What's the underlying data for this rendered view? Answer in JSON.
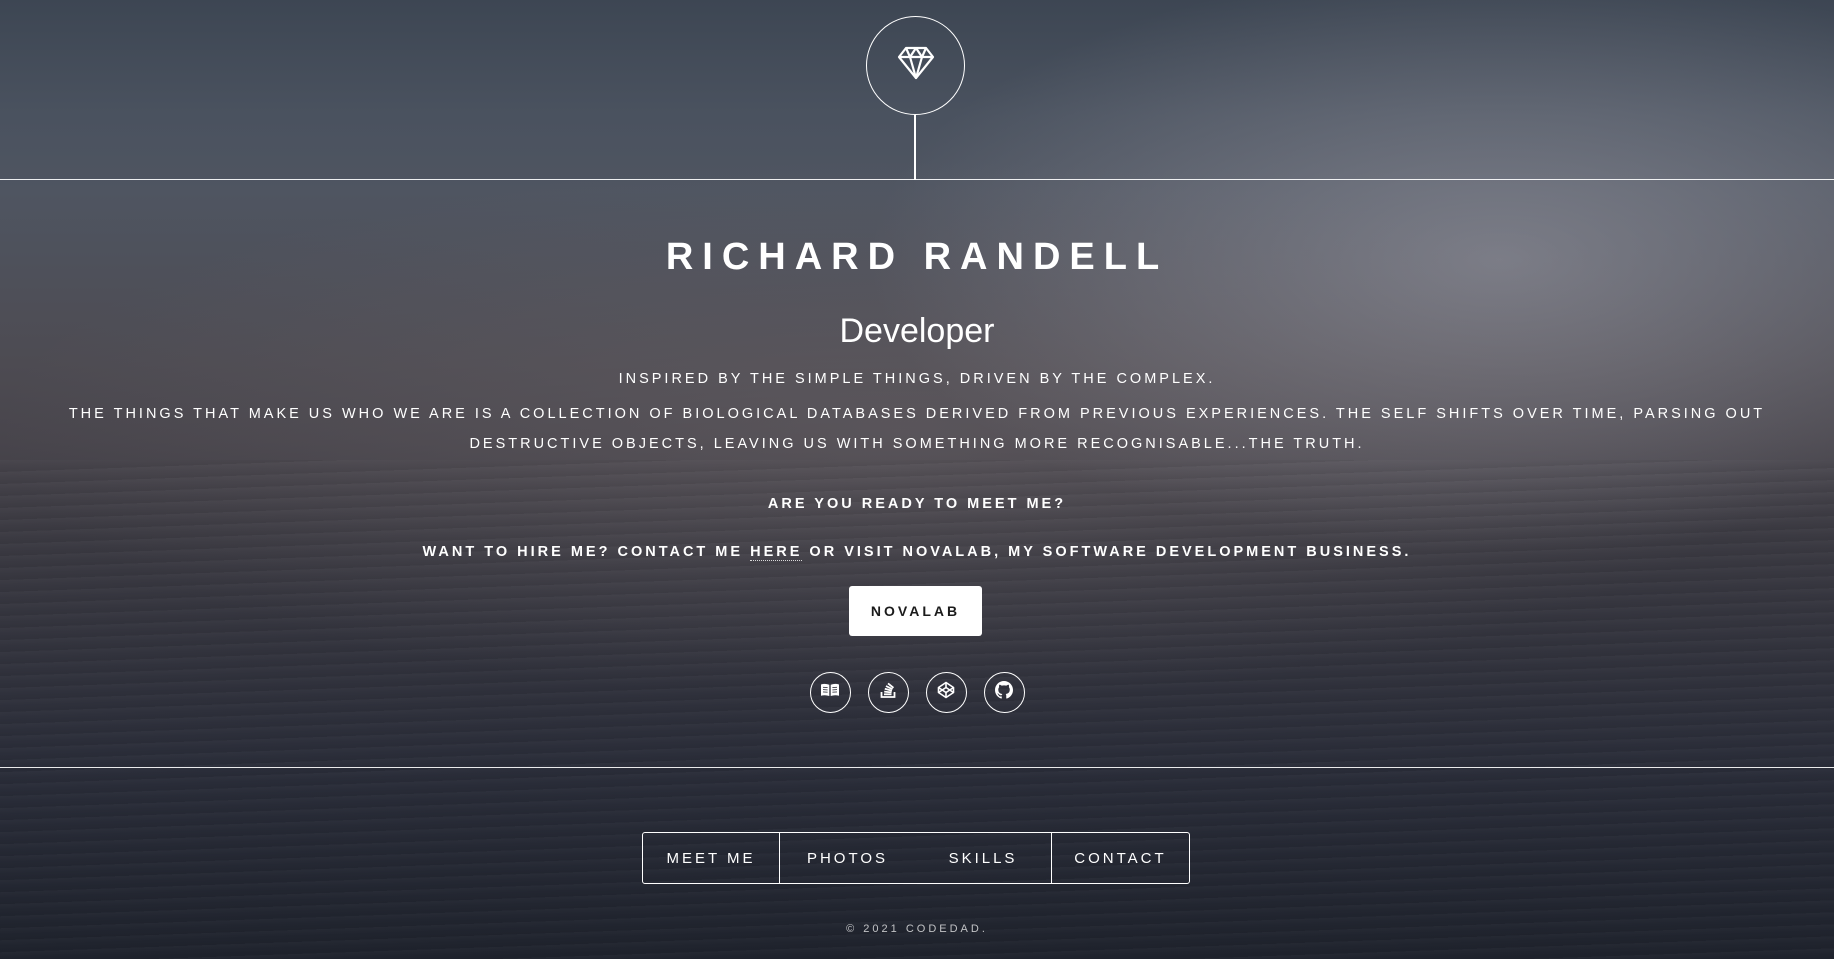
{
  "header": {
    "logo_icon": "diamond-icon"
  },
  "intro": {
    "name": "RICHARD RANDELL",
    "role": "Developer",
    "tagline": "INSPIRED BY THE SIMPLE THINGS, DRIVEN BY THE COMPLEX.",
    "bio": "THE THINGS THAT MAKE US WHO WE ARE IS A COLLECTION OF BIOLOGICAL DATABASES DERIVED FROM PREVIOUS EXPERIENCES. THE SELF SHIFTS OVER TIME, PARSING OUT DESTRUCTIVE OBJECTS, LEAVING US WITH SOMETHING MORE RECOGNISABLE...THE TRUTH.",
    "ready": "ARE YOU READY TO MEET ME?",
    "hire_prefix": "WANT TO HIRE ME? CONTACT ME ",
    "hire_link": "HERE",
    "hire_suffix": " OR VISIT NOVALAB, MY SOFTWARE DEVELOPMENT BUSINESS.",
    "cta_label": "NOVALAB"
  },
  "socials": [
    {
      "icon": "book-icon"
    },
    {
      "icon": "stackoverflow-icon"
    },
    {
      "icon": "codepen-icon"
    },
    {
      "icon": "github-icon"
    }
  ],
  "nav": {
    "items": [
      "MEET ME",
      "PHOTOS",
      "SKILLS",
      "CONTACT"
    ]
  },
  "footer": {
    "copyright": "© 2021 CODEDAD."
  },
  "colors": {
    "text": "#ffffff",
    "button_bg": "#ffffff",
    "button_text": "#1b1b1b"
  }
}
